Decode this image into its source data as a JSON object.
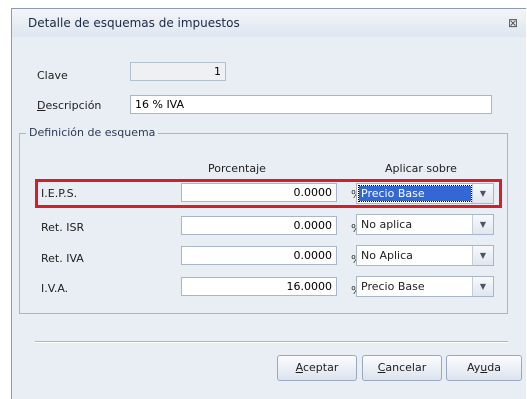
{
  "window": {
    "title": "Detalle de esquemas de impuestos",
    "close_glyph": "⊠"
  },
  "clave": {
    "label": "Clave",
    "value": "1"
  },
  "descripcion": {
    "label_first": "D",
    "label_rest": "escripción",
    "value": "16 % IVA"
  },
  "scheme": {
    "group_title": "Definición de esquema",
    "col_percentage": "Porcentaje",
    "col_apply": "Aplicar sobre",
    "percent_symbol": "%",
    "rows": [
      {
        "label": "I.E.P.S.",
        "value": "0.0000",
        "apply": "Precio Base",
        "selected": true
      },
      {
        "label": "Ret. ISR",
        "value": "0.0000",
        "apply": "No aplica",
        "selected": false
      },
      {
        "label": "Ret. IVA",
        "value": "0.0000",
        "apply": "No Aplica",
        "selected": false
      },
      {
        "label": "I.V.A.",
        "value": "16.0000",
        "apply": "Precio Base",
        "selected": false
      }
    ]
  },
  "buttons": {
    "accept_first": "A",
    "accept_rest": "ceptar",
    "cancel_first": "C",
    "cancel_rest": "ancelar",
    "help_first": "Ay",
    "help_u": "u",
    "help_rest": "da"
  },
  "colors": {
    "highlight": "#d0202a",
    "selection": "#3367d6",
    "dialog_bg": "#e9eef5"
  }
}
